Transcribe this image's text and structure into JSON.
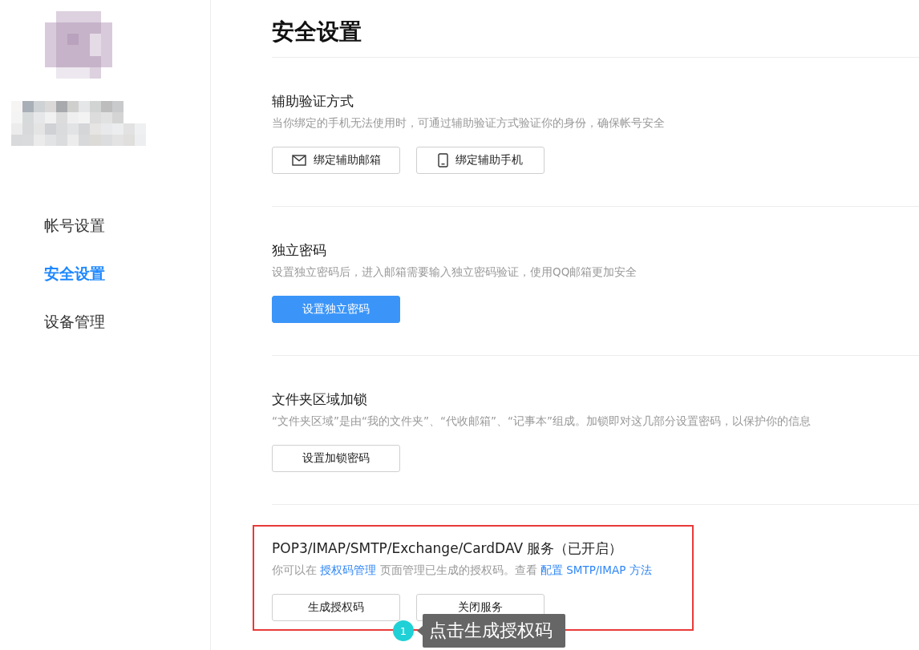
{
  "sidebar": {
    "nav": [
      {
        "label": "帐号设置",
        "selected": false
      },
      {
        "label": "安全设置",
        "selected": true
      },
      {
        "label": "设备管理",
        "selected": false
      }
    ]
  },
  "page_title": "安全设置",
  "sections": [
    {
      "title": "辅助验证方式",
      "highlighted": false,
      "description": [
        {
          "kind": "text",
          "text": "当你绑定的手机无法使用时，可通过辅助验证方式验证你的身份，确保帐号安全"
        }
      ],
      "buttons": [
        {
          "kind": "email",
          "label": "绑定辅助邮箱"
        },
        {
          "kind": "phone",
          "label": "绑定辅助手机"
        }
      ]
    },
    {
      "title": "独立密码",
      "highlighted": false,
      "description": [
        {
          "kind": "text",
          "text": "设置独立密码后，进入邮箱需要输入独立密码验证，使用QQ邮箱更加安全"
        }
      ],
      "buttons": [
        {
          "kind": "primary",
          "label": "设置独立密码"
        }
      ]
    },
    {
      "title": "文件夹区域加锁",
      "highlighted": false,
      "description": [
        {
          "kind": "text",
          "text": "“文件夹区域”是由“我的文件夹”、“代收邮箱”、“记事本”组成。加锁即对这几部分设置密码，以保护你的信息"
        }
      ],
      "buttons": [
        {
          "kind": "plain",
          "label": "设置加锁密码"
        }
      ]
    },
    {
      "title": "POP3/IMAP/SMTP/Exchange/CardDAV 服务（已开启）",
      "highlighted": true,
      "description": [
        {
          "kind": "text",
          "text": "你可以在 "
        },
        {
          "kind": "link",
          "text": "授权码管理"
        },
        {
          "kind": "text",
          "text": " 页面管理已生成的授权码。查看 "
        },
        {
          "kind": "link",
          "text": "配置 SMTP/IMAP 方法"
        }
      ],
      "buttons": [
        {
          "kind": "plain",
          "label": "生成授权码"
        },
        {
          "kind": "plain",
          "label": "关闭服务"
        }
      ]
    }
  ],
  "annotation": {
    "step": "1",
    "text": "点击生成授权码"
  }
}
